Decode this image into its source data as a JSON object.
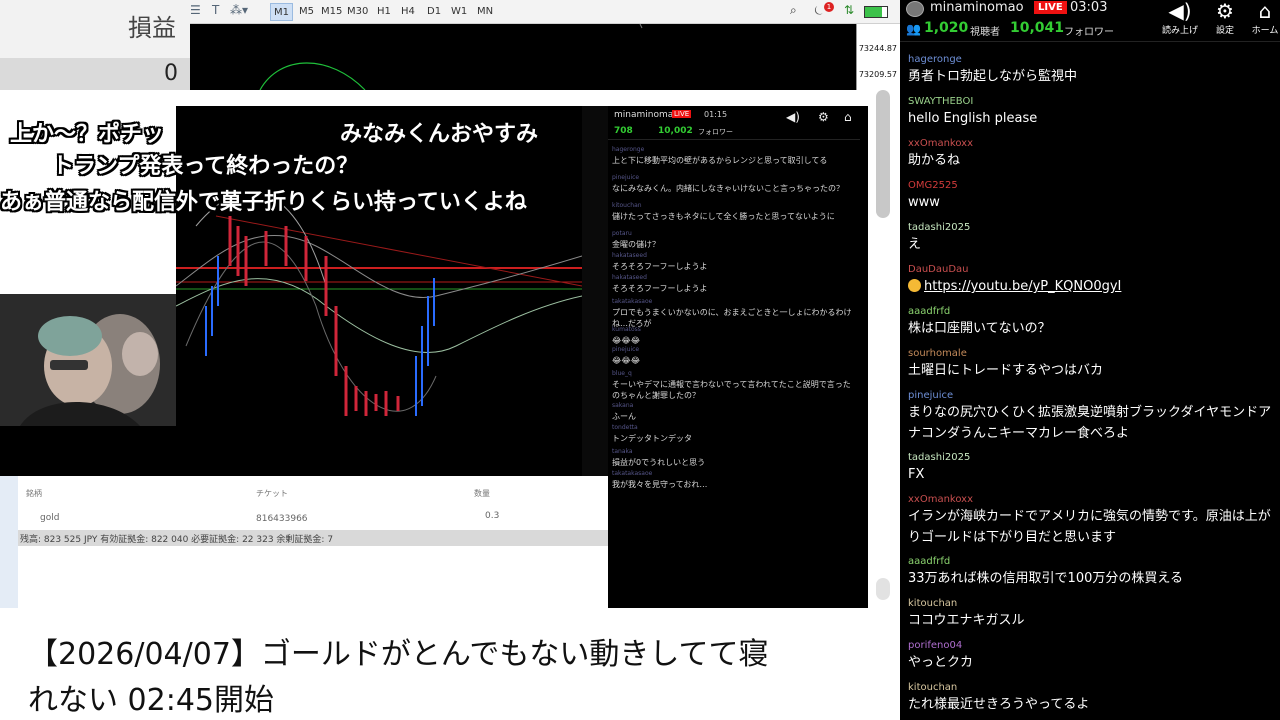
{
  "pl_panel": {
    "label": "損益",
    "value": "0"
  },
  "mt_toolbar": {
    "timeframes": [
      "M1",
      "M5",
      "M15",
      "M30",
      "H1",
      "H4",
      "D1",
      "W1",
      "MN"
    ],
    "active_timeframe": "M1",
    "notification_count": "1",
    "battery_level": 0.75
  },
  "price_scale": {
    "ticks": [
      "73244.87",
      "73209.57"
    ]
  },
  "video": {
    "overlay_comments": [
      "上か～？ポチッ",
      "みなみくんおやすみ",
      "トランプ発表って終わったの？",
      "あぁ普通なら配信外で菓子折りくらい持っていくよね"
    ],
    "chat": {
      "streamer": "minaminomao",
      "live": "LIVE",
      "time": "01:15",
      "viewers": "708",
      "followers": "10,002",
      "followers_label": "フォロワー",
      "messages": [
        {
          "user": "hageronge",
          "text": "上と下に移動平均の壁があるからレンジと思って取引してる"
        },
        {
          "user": "pinejuice",
          "text": "なにみなみくん。内緒にしなきゃいけないこと言っちゃったの？"
        },
        {
          "user": "kitouchan",
          "text": "儲けたってさっきもネタにして全く勝ったと思ってないように"
        },
        {
          "user": "potaru",
          "text": "金曜の儲け？"
        },
        {
          "user": "hakataseed",
          "text": "そろそろフーフーしようよ"
        },
        {
          "user": "hakataseed",
          "text": "そろそろフーフーしようよ"
        },
        {
          "user": "takatakasaoe",
          "text": "プロでもうまくいかないのに、おまえごときと一しょにわかるわけね…だろが"
        },
        {
          "user": "kumatoss",
          "text": "😂😂😂"
        },
        {
          "user": "pinejuice",
          "text": "😂😂😂"
        },
        {
          "user": "blue_q",
          "text": "そーいやデマに通報で言わないでって言われてたこと説明で言ったのちゃんと謝罪したの？"
        },
        {
          "user": "sakana",
          "text": "ふーん"
        },
        {
          "user": "tondetta",
          "text": "トンデッタトンデッタ"
        },
        {
          "user": "tanaka",
          "text": "損益が0でうれしいと思う"
        },
        {
          "user": "takatakasaoe",
          "text": "我が我々を見守っておれ…"
        }
      ]
    },
    "mt_terminal": {
      "col_symbol": "銘柄",
      "col_ticket": "チケット",
      "col_volume": "数量",
      "symbol": "gold",
      "ticket": "816433966",
      "volume": "0.3",
      "balance_line": "残高: 823 525 JPY  有効証拠金: 822 040  必要証拠金: 22 323  余剰証拠金: 7"
    }
  },
  "video_title": {
    "line1": "【2026/04/07】ゴールドがとんでもない動きしてて寝",
    "line2": "れない 02:45開始"
  },
  "chat_panel": {
    "streamer": "minaminomao",
    "live": "LIVE",
    "time": "03:03",
    "viewers": "1,020",
    "viewers_label": "視聴者",
    "followers": "10,041",
    "followers_label": "フォロワー",
    "buttons": [
      {
        "icon": "speaker-icon",
        "label": "読み上げ"
      },
      {
        "icon": "gear-icon",
        "label": "設定"
      },
      {
        "icon": "home-icon",
        "label": "ホーム"
      }
    ],
    "messages": [
      {
        "user": "hageronge",
        "user_color": "#6e8fd6",
        "text": "勇者トロ勃起しながら監視中"
      },
      {
        "user": "SWAYTHEBOI",
        "user_color": "#9ad18b",
        "text": "hello English please"
      },
      {
        "user": "xxOmankoxx",
        "user_color": "#c84f4f",
        "text": "助かるね"
      },
      {
        "user": "OMG2525",
        "user_color": "#d23b3b",
        "text": "www"
      },
      {
        "user": "tadashi2025",
        "user_color": "#c7e7c0",
        "text": "え"
      },
      {
        "user": "DauDauDau",
        "user_color": "#c84f4f",
        "text": "https://youtu.be/yP_KQNO0gyI",
        "emoji": true,
        "link": true
      },
      {
        "user": "aaadfrfd",
        "user_color": "#8bd36f",
        "text": "株は口座開いてないの？"
      },
      {
        "user": "sourhomale",
        "user_color": "#c38a5a",
        "text": "土曜日にトレードするやつはバカ"
      },
      {
        "user": "pinejuice",
        "user_color": "#6e8fd6",
        "text": "まりなの尻穴ひくひく拡張激臭逆噴射ブラックダイヤモンドアナコンダうんこキーマカレー食べろよ"
      },
      {
        "user": "tadashi2025",
        "user_color": "#c7e7c0",
        "text": "FX"
      },
      {
        "user": "xxOmankoxx",
        "user_color": "#c84f4f",
        "text": "イランが海峡カードでアメリカに強気の情勢です。原油は上がりゴールドは下がり目だと思います"
      },
      {
        "user": "aaadfrfd",
        "user_color": "#8bd36f",
        "text": "33万あれば株の信用取引で100万分の株買える"
      },
      {
        "user": "kitouchan",
        "user_color": "#d7c7a0",
        "text": "ココウエナキガスル"
      },
      {
        "user": "porifeno04",
        "user_color": "#b06fd0",
        "text": "やっとクカ"
      },
      {
        "user": "kitouchan",
        "user_color": "#d7c7a0",
        "text": "たれ様最近せきろうやってるよ"
      }
    ]
  }
}
